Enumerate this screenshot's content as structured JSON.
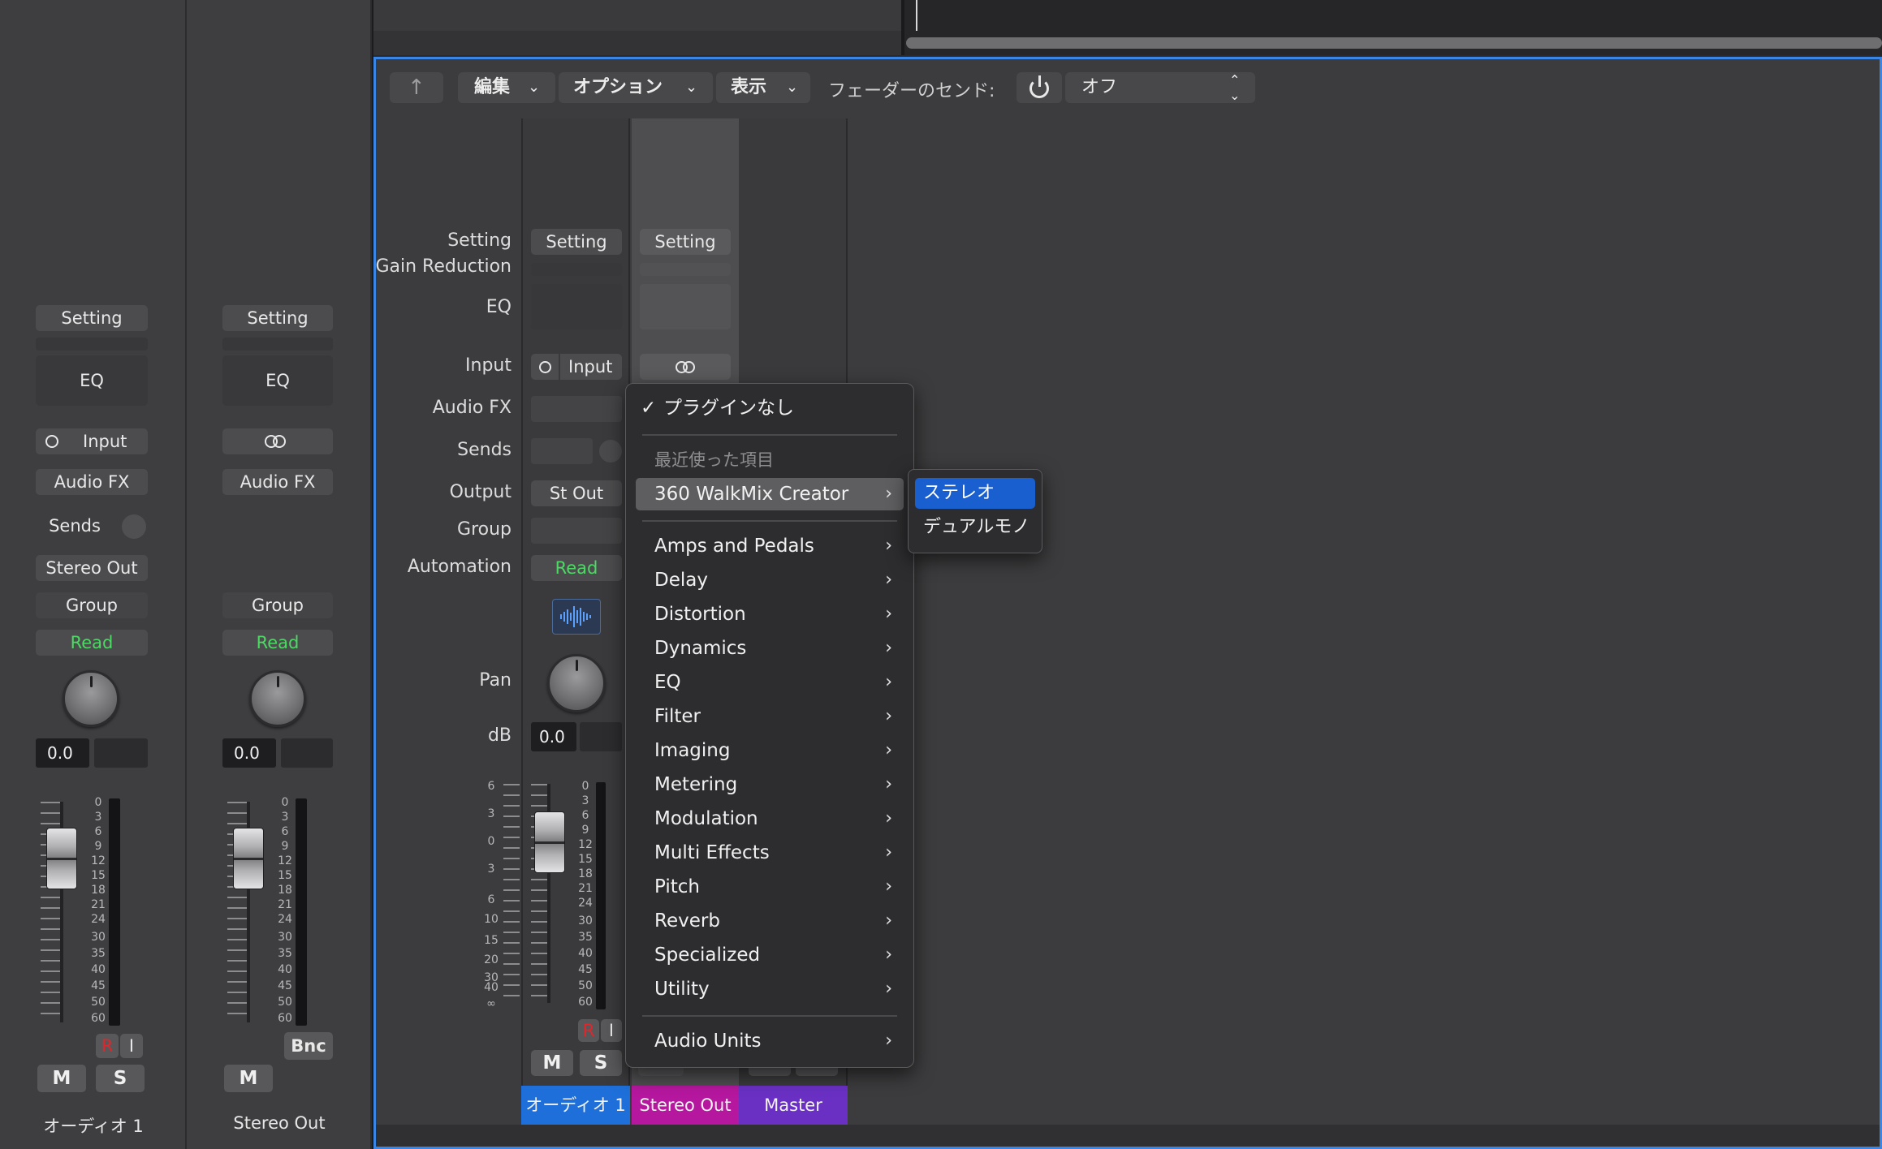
{
  "left_strips": [
    {
      "name": "オーディオ 1",
      "setting": "Setting",
      "eq": "EQ",
      "input": "Input",
      "audio_fx": "Audio FX",
      "sends": "Sends",
      "output": "Stereo Out",
      "group": "Group",
      "automation": "Read",
      "db": "0.0",
      "r": "R",
      "i": "I",
      "m": "M",
      "s": "S"
    },
    {
      "name": "Stereo Out",
      "setting": "Setting",
      "eq": "EQ",
      "audio_fx": "Audio FX",
      "group": "Group",
      "automation": "Read",
      "db": "0.0",
      "bnc": "Bnc",
      "m": "M"
    }
  ],
  "fader_scale": [
    "0",
    "3",
    "6",
    "9",
    "12",
    "15",
    "18",
    "21",
    "24",
    "30",
    "35",
    "40",
    "45",
    "50",
    "60"
  ],
  "toolbar": {
    "edit": "編集",
    "options": "オプション",
    "view": "表示",
    "fader_send_label": "フェーダーのセンド:",
    "fader_send_value": "オフ"
  },
  "labels": {
    "setting": "Setting",
    "gain_reduction": "Gain Reduction",
    "eq": "EQ",
    "input": "Input",
    "audio_fx": "Audio FX",
    "sends": "Sends",
    "output": "Output",
    "group": "Group",
    "automation": "Automation",
    "pan": "Pan",
    "db": "dB"
  },
  "mixer": {
    "strip1": {
      "setting": "Setting",
      "input": "Input",
      "output": "St Out",
      "automation": "Read",
      "db": "0.0",
      "r": "R",
      "i": "I",
      "m": "M",
      "s": "S"
    },
    "strip2": {
      "setting": "Setting"
    },
    "level_scale": [
      "6",
      "3",
      "0",
      "3",
      "6",
      "10",
      "15",
      "20",
      "30",
      "40",
      "∞"
    ],
    "meter_scale": [
      "0",
      "3",
      "6",
      "9",
      "12",
      "15",
      "18",
      "21",
      "24",
      "30",
      "35",
      "40",
      "45",
      "50",
      "60"
    ],
    "names": [
      "オーディオ 1",
      "Stereo Out",
      "Master"
    ]
  },
  "plugin_menu": {
    "no_plugin": "プラグインなし",
    "recent_header": "最近使った項目",
    "recent_item": "360 WalkMix Creator",
    "categories": [
      "Amps and Pedals",
      "Delay",
      "Distortion",
      "Dynamics",
      "EQ",
      "Filter",
      "Imaging",
      "Metering",
      "Modulation",
      "Multi Effects",
      "Pitch",
      "Reverb",
      "Specialized",
      "Utility"
    ],
    "audio_units": "Audio Units"
  },
  "submenu": {
    "stereo": "ステレオ",
    "dual_mono": "デュアルモノ"
  },
  "colors": {
    "accent": "#1a5fd0",
    "read_green": "#4cd964",
    "rec_red": "#e0262b",
    "strip_blue": "#1e6fd9",
    "strip_magenta": "#b5179e",
    "strip_purple": "#6a30c4"
  }
}
